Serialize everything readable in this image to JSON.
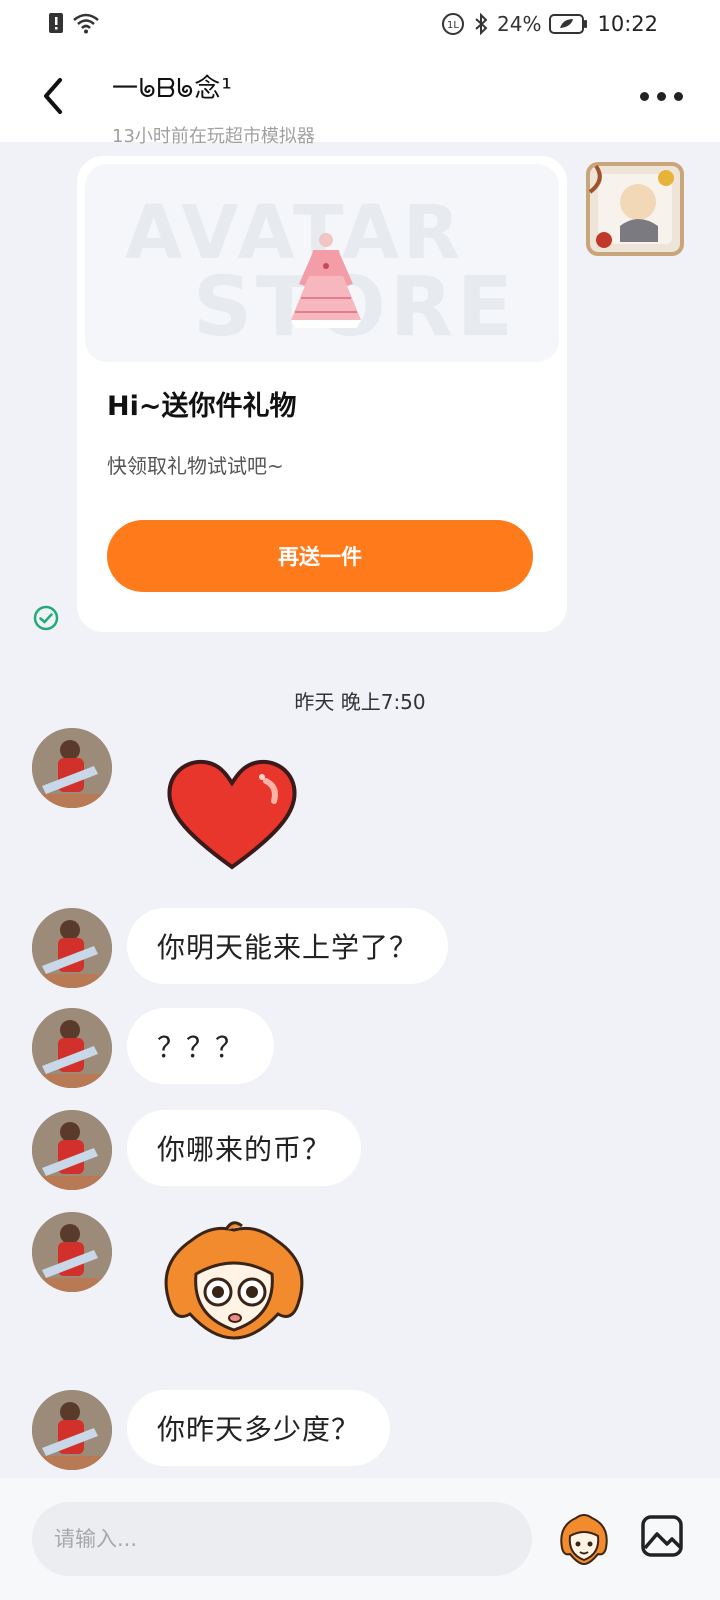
{
  "status_bar": {
    "battery": "24%",
    "time": "10:22",
    "icons": [
      "sim-alert-icon",
      "wifi-icon",
      "hd-call-icon",
      "bluetooth-icon",
      "battery-saver-icon",
      "battery-icon"
    ]
  },
  "header": {
    "title": "一ᖚᗷᖚ念¹",
    "status": "13小时前在玩超市模拟器",
    "back_icon": "back-arrow-icon",
    "more_icon": "more-dots-icon"
  },
  "gift_card": {
    "watermark_top": "AVATAR",
    "watermark_bottom": "STORE",
    "title": "Hi~送你件礼物",
    "subtitle": "快领取礼物试试吧~",
    "button_label": "再送一件",
    "accent": "#FF7A1A"
  },
  "timestamp": "昨天 晚上7:50",
  "messages": [
    {
      "type": "sticker",
      "sticker": "heart-sticker"
    },
    {
      "type": "text",
      "text": "你明天能来上学了？"
    },
    {
      "type": "text",
      "text": "？？？"
    },
    {
      "type": "text",
      "text": "你哪来的币？"
    },
    {
      "type": "sticker",
      "sticker": "shocked-mascot-sticker"
    },
    {
      "type": "text",
      "text": "你昨天多少度？"
    }
  ],
  "input": {
    "placeholder": "请输入..."
  },
  "colors": {
    "background": "#F0F2F7",
    "accent": "#FF7A1A",
    "sent_check": "#22AA77"
  }
}
